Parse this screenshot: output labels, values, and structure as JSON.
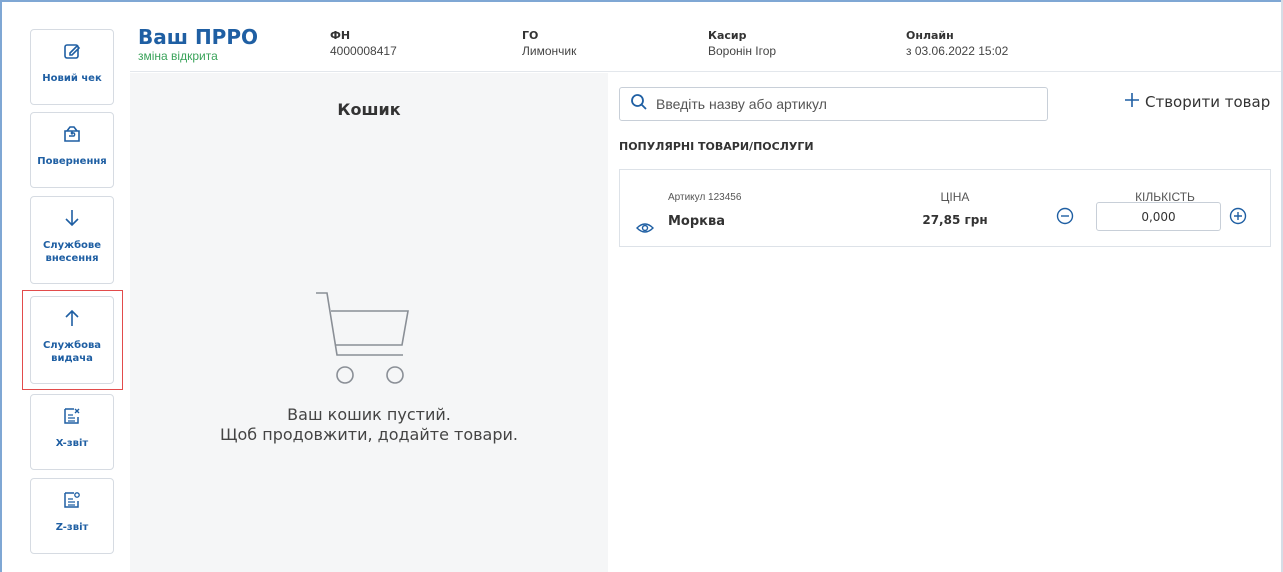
{
  "sidebar": {
    "items": [
      {
        "label": "Новий чек",
        "icon": "edit-icon"
      },
      {
        "label": "Повернення",
        "icon": "return-icon"
      },
      {
        "label": "Службове внесення",
        "icon": "arrow-down-icon"
      },
      {
        "label": "Службова видача",
        "icon": "arrow-up-icon"
      },
      {
        "label": "X-звіт",
        "icon": "x-report-icon"
      },
      {
        "label": "Z-звіт",
        "icon": "z-report-icon"
      }
    ]
  },
  "header": {
    "brand_title": "Ваш ПРРО",
    "brand_status": "зміна відкрита",
    "fn_label": "ФН",
    "fn_value": "4000008417",
    "go_label": "ГО",
    "go_value": "Лимончик",
    "cashier_label": "Касир",
    "cashier_value": "Воронін Ігор",
    "online_label": "Онлайн",
    "online_value": "з 03.06.2022 15:02"
  },
  "cart": {
    "title": "Кошик",
    "empty_line1": "Ваш кошик пустий.",
    "empty_line2": "Щоб продовжити, додайте товари."
  },
  "search": {
    "placeholder": "Введіть назву або артикул"
  },
  "create_product_label": "Створити товар",
  "popular": {
    "title": "ПОПУЛЯРНІ ТОВАРИ/ПОСЛУГИ",
    "price_header": "ЦІНА",
    "qty_header": "КІЛЬКІСТЬ",
    "items": [
      {
        "article": "Артикул 123456",
        "name": "Морква",
        "price": "27,85 грн",
        "quantity": "0,000"
      }
    ]
  },
  "colors": {
    "accent": "#1f5fa3",
    "status_open": "#3aa35a",
    "highlight": "#e24b4b"
  }
}
